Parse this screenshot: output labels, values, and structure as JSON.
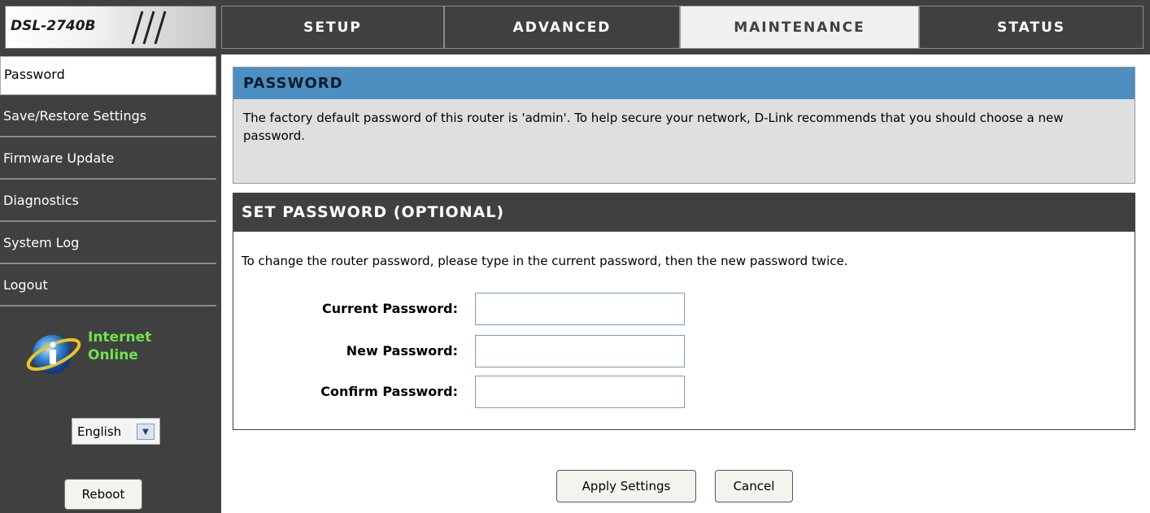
{
  "header": {
    "model": "DSL-2740B",
    "tabs": [
      {
        "label": "SETUP",
        "active": false
      },
      {
        "label": "ADVANCED",
        "active": false
      },
      {
        "label": "MAINTENANCE",
        "active": true
      },
      {
        "label": "STATUS",
        "active": false
      }
    ]
  },
  "sidebar": {
    "items": [
      {
        "label": "Password",
        "active": true
      },
      {
        "label": "Save/Restore Settings",
        "active": false
      },
      {
        "label": "Firmware Update",
        "active": false
      },
      {
        "label": "Diagnostics",
        "active": false
      },
      {
        "label": "System Log",
        "active": false
      },
      {
        "label": "Logout",
        "active": false
      }
    ],
    "status": {
      "line1": "Internet",
      "line2": "Online",
      "icon": "info-globe-icon"
    },
    "language": {
      "selected": "English"
    },
    "reboot_label": "Reboot"
  },
  "password_section": {
    "title": "PASSWORD",
    "description": "The factory default password of this router is 'admin'. To help secure your network, D-Link recommends that you should choose a new password."
  },
  "set_password_section": {
    "title": "SET PASSWORD (OPTIONAL)",
    "description": "To change the router password, please type in the current password, then the new password twice.",
    "fields": {
      "current": {
        "label": "Current Password:",
        "value": ""
      },
      "new": {
        "label": "New Password:",
        "value": ""
      },
      "confirm": {
        "label": "Confirm Password:",
        "value": ""
      }
    }
  },
  "actions": {
    "apply_label": "Apply Settings",
    "cancel_label": "Cancel"
  },
  "colors": {
    "dark": "#404040",
    "accent_blue": "#4c8fc0",
    "status_green": "#6ee34a"
  }
}
